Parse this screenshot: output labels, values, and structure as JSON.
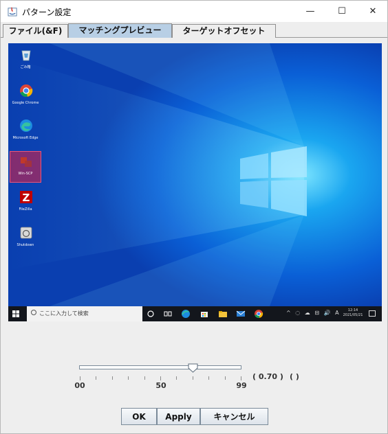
{
  "window": {
    "title": "パターン設定",
    "minimize_glyph": "—",
    "maximize_glyph": "☐",
    "close_glyph": "✕"
  },
  "tabs": [
    {
      "label": "ファイル(&F)",
      "selected": false
    },
    {
      "label": "マッチングプレビュー",
      "selected": true
    },
    {
      "label": "ターゲットオフセット",
      "selected": false
    }
  ],
  "preview": {
    "desktop_icons": [
      {
        "label": "ごみ箱",
        "icon": "recycle-bin-icon"
      },
      {
        "label": "Google Chrome",
        "icon": "chrome-icon"
      },
      {
        "label": "Microsoft Edge",
        "icon": "edge-icon"
      },
      {
        "label": "Win-SCP",
        "icon": "app-icon",
        "highlighted": true
      },
      {
        "label": "FileZilla",
        "icon": "filezilla-icon"
      },
      {
        "label": "Shutdown",
        "icon": "shutdown-icon"
      }
    ],
    "taskbar": {
      "search_placeholder": "ここに入力して検索",
      "tray_text": "^ ◌ ☁ ⊟ 🔊 A",
      "clock_time": "12:14",
      "clock_date": "2021/05/21"
    },
    "colors": {
      "desktop_bg": "#0a5fd6",
      "taskbar_bg": "#13161c",
      "highlight": "#e61e3c"
    }
  },
  "slider": {
    "min_label": "00",
    "mid_label": "50",
    "max_label": "99",
    "value_fraction": 0.7,
    "value_text": "( 0.70 )",
    "extra_text": "(        )"
  },
  "buttons": {
    "ok": "OK",
    "apply": "Apply",
    "cancel": "キャンセル"
  }
}
